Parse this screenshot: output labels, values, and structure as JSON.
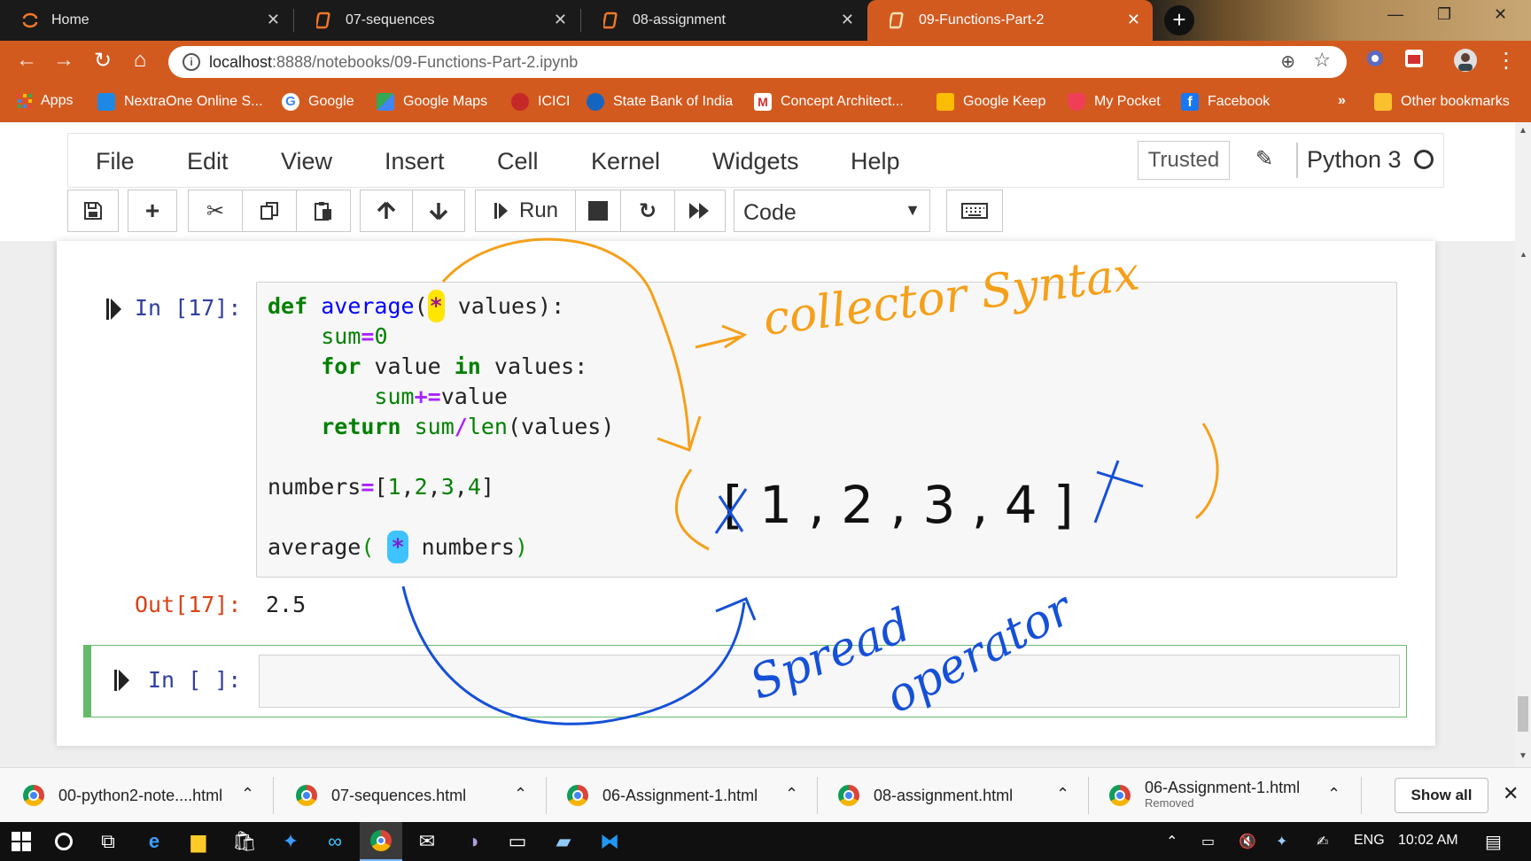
{
  "browser": {
    "tabs": [
      {
        "label": "Home",
        "icon": "jupyter-icon",
        "active": false
      },
      {
        "label": "07-sequences",
        "icon": "notebook-icon",
        "active": false
      },
      {
        "label": "08-assignment",
        "icon": "notebook-icon",
        "active": false
      },
      {
        "label": "09-Functions-Part-2",
        "icon": "notebook-icon",
        "active": true
      }
    ],
    "url_host": "localhost",
    "url_rest": ":8888/notebooks/09-Functions-Part-2.ipynb",
    "accent_color": "#d35a1f",
    "bookmarks": [
      {
        "label": "Apps",
        "color": "#e8453c"
      },
      {
        "label": "NextraOne Online S...",
        "color": "#1e88e5"
      },
      {
        "label": "Google",
        "color": "#ffffff"
      },
      {
        "label": "Google Maps",
        "color": "#34a853"
      },
      {
        "label": "ICICI",
        "color": "#c62828"
      },
      {
        "label": "State Bank of India",
        "color": "#1565c0"
      },
      {
        "label": "Concept Architect...",
        "color": "#ffffff"
      },
      {
        "label": "Google Keep",
        "color": "#fbbc04"
      },
      {
        "label": "My Pocket",
        "color": "#ef3f56"
      },
      {
        "label": "Facebook",
        "color": "#1877f2"
      }
    ],
    "bookmarks_overflow": "»",
    "other_bookmarks": "Other bookmarks"
  },
  "jupyter": {
    "menu": [
      "File",
      "Edit",
      "View",
      "Insert",
      "Cell",
      "Kernel",
      "Widgets",
      "Help"
    ],
    "trusted": "Trusted",
    "kernel": "Python 3",
    "run_label": "Run",
    "cell_type": "Code"
  },
  "cell1": {
    "in_prompt": "In [17]:",
    "out_prompt": "Out[17]:",
    "output": "2.5"
  },
  "cell2": {
    "in_prompt": "In [ ]:"
  },
  "annotations": {
    "collector": "→ collector Syntax",
    "list": "( [ 1 , 2 , 3 , 4 ] )",
    "spread": "Spread operator"
  },
  "downloads": [
    {
      "name": "00-python2-note....html",
      "sub": ""
    },
    {
      "name": "07-sequences.html",
      "sub": ""
    },
    {
      "name": "06-Assignment-1.html",
      "sub": ""
    },
    {
      "name": "08-assignment.html",
      "sub": ""
    },
    {
      "name": "06-Assignment-1.html",
      "sub": "Removed"
    }
  ],
  "show_all": "Show all",
  "taskbar": {
    "lang": "ENG",
    "time": "10:02 AM"
  }
}
